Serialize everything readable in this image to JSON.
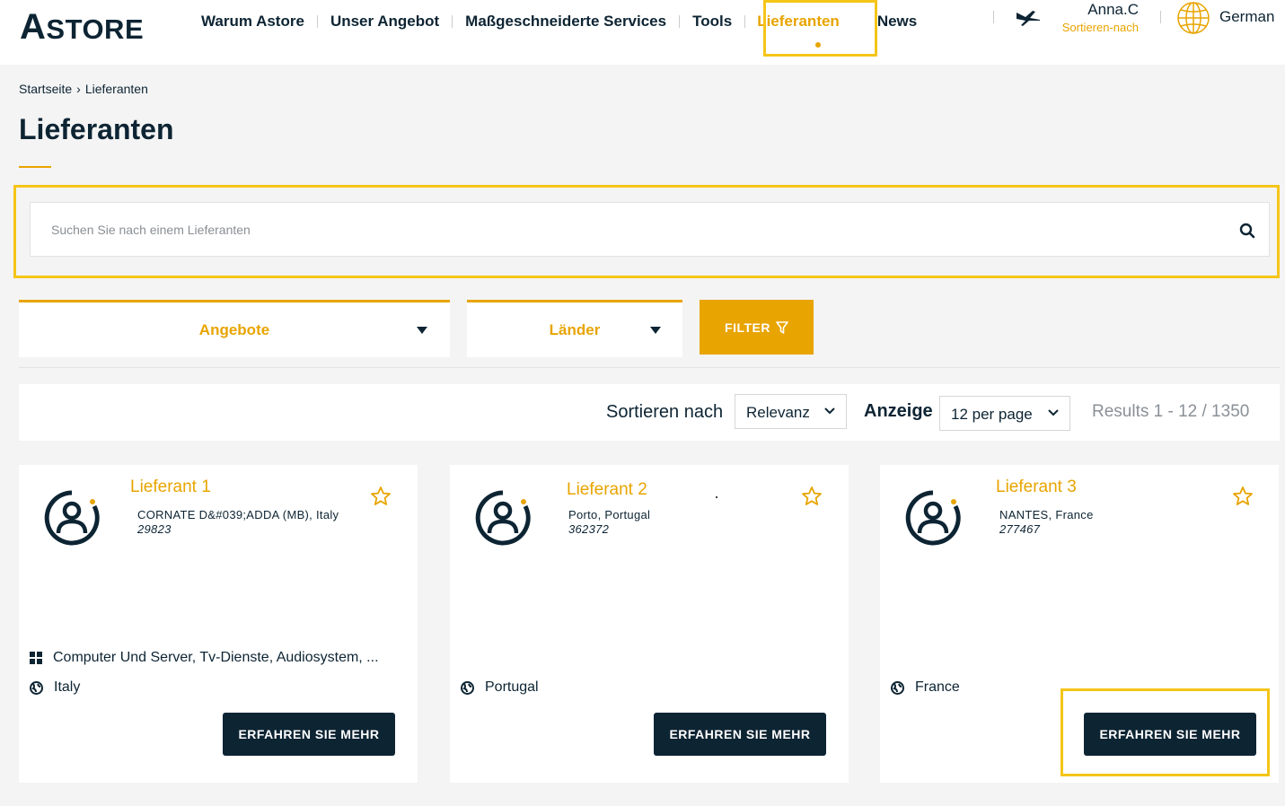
{
  "header": {
    "logo": {
      "first": "A",
      "rest": "STORE"
    },
    "nav": [
      {
        "label": "Warum Astore"
      },
      {
        "label": "Unser Angebot"
      },
      {
        "label": "Maßgeschneiderte Services"
      },
      {
        "label": "Tools"
      },
      {
        "label": "Lieferanten",
        "active": true
      },
      {
        "label": "News"
      }
    ],
    "user": {
      "name": "Anna.C",
      "subtitle": "Sortieren-nach",
      "icon": "plane-icon"
    },
    "language": {
      "label": "German",
      "icon": "globe-icon"
    }
  },
  "breadcrumb": {
    "home": "Startseite",
    "separator": "›",
    "current": "Lieferanten"
  },
  "page_title": "Lieferanten",
  "search": {
    "placeholder": "Suchen Sie nach einem Lieferanten",
    "value": "",
    "icon": "search-icon"
  },
  "filters": {
    "offers_label": "Angebote",
    "countries_label": "Länder",
    "filter_button": "FILTER"
  },
  "sort_bar": {
    "sort_label": "Sortieren nach",
    "sort_value": "Relevanz",
    "show_label": "Anzeige",
    "per_page_value": "12 per page",
    "results": "Results 1 - 12 / 1350"
  },
  "cards": [
    {
      "name": "Lieferant 1",
      "address": "CORNATE D&#039;ADDA (MB), Italy",
      "code": "29823",
      "categories": "Computer Und Server, Tv-Dienste, Audiosystem, ...",
      "country": "Italy",
      "button": "ERFAHREN SIE MEHR"
    },
    {
      "name": "Lieferant 2",
      "address": "Porto, Portugal",
      "code": "362372",
      "categories": "",
      "country": "Portugal",
      "button": "ERFAHREN SIE MEHR"
    },
    {
      "name": "Lieferant 3",
      "address": "NANTES, France",
      "code": "277467",
      "categories": "",
      "country": "France",
      "button": "ERFAHREN SIE MEHR"
    }
  ],
  "colors": {
    "accent": "#e8a400",
    "navy": "#0d2433",
    "highlight": "#f5c518"
  }
}
